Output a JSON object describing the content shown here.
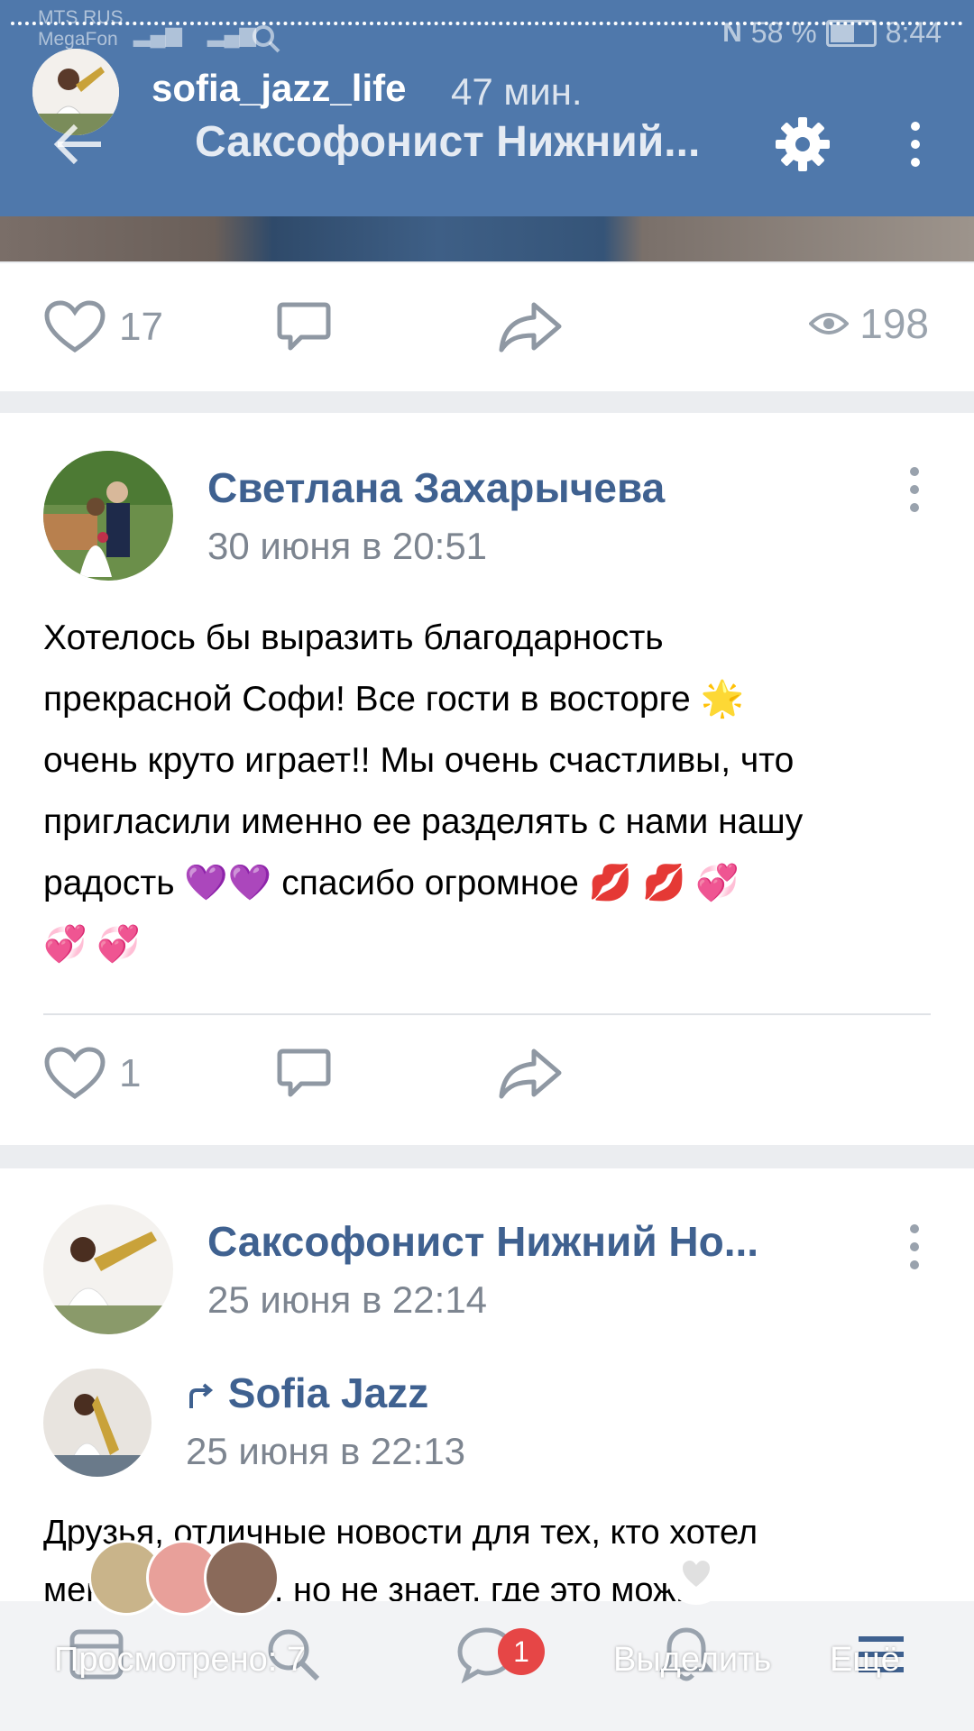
{
  "status_bar": {
    "carrier1": "MTS RUS",
    "carrier2": "MegaFon",
    "battery": "58 %",
    "time": "8:44"
  },
  "story": {
    "username": "sofia_jazz_life",
    "time_ago": "47 мин."
  },
  "header": {
    "title": "Саксофонист Нижний..."
  },
  "top_post_actions": {
    "likes": "17",
    "views": "198"
  },
  "comment1": {
    "author": "Светлана Захарычева",
    "date": "30 июня в 20:51",
    "text_lines": [
      "Хотелось бы выразить благодарность",
      "прекрасной Софи! Все гости в восторге 🌟",
      "очень круто играет!! Мы очень счастливы, что",
      "пригласили именно ее разделять с нами нашу",
      "радость 💜💜 спасибо огромное 💋 💋 💞",
      "💞 💞"
    ],
    "likes": "1"
  },
  "post2": {
    "author": "Саксофонист Нижний Но...",
    "date": "25 июня в 22:14",
    "repost_author": "Sofia Jazz",
    "repost_date": "25 июня в 22:13",
    "text_lines": [
      "Друзья, отличные новости для тех, кто хотел",
      "меня слышать, но не знает, где это можно"
    ]
  },
  "story_overlay": {
    "viewed": "Просмотрено: 7",
    "select": "Выделить",
    "more": "Ещё",
    "messages_badge": "1"
  },
  "colors": {
    "header_bg": "#4f78ab",
    "author_link": "#3f6190",
    "badge": "#e64646"
  }
}
